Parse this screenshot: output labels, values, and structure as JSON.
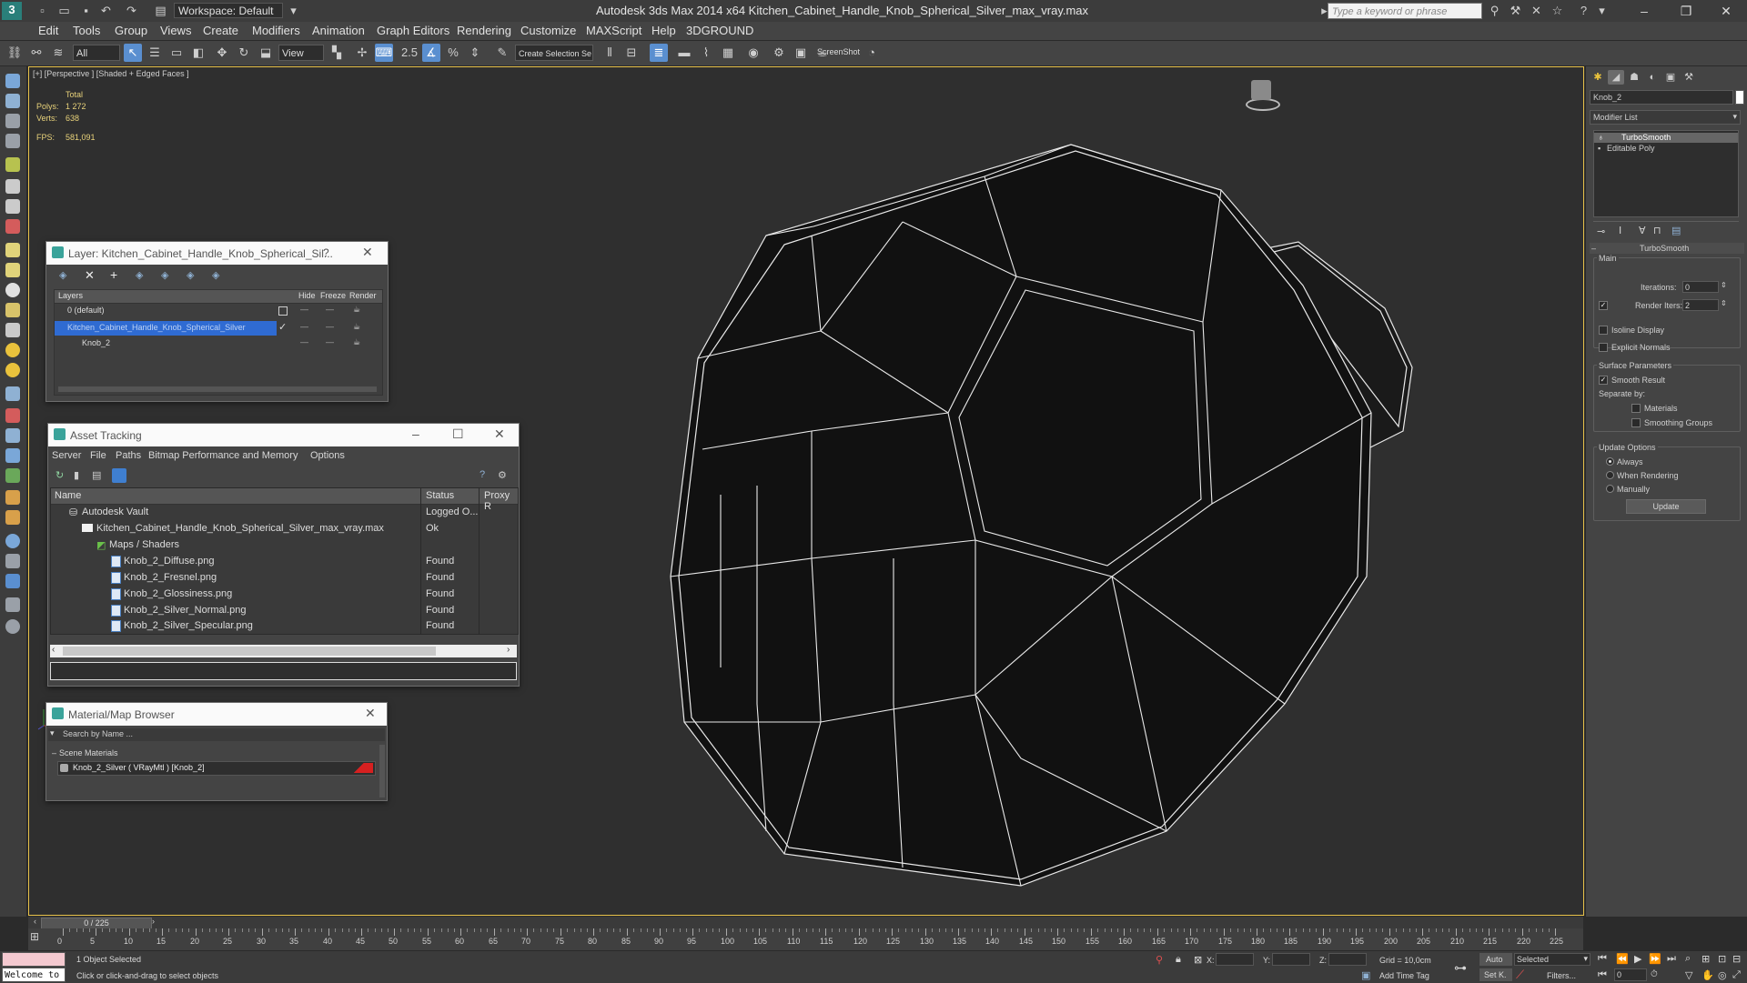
{
  "titlebar": {
    "workspace": "Workspace: Default",
    "title": "Autodesk 3ds Max  2014 x64     Kitchen_Cabinet_Handle_Knob_Spherical_Silver_max_vray.max",
    "search_placeholder": "Type a keyword or phrase"
  },
  "menu": [
    "Edit",
    "Tools",
    "Group",
    "Views",
    "Create",
    "Modifiers",
    "Animation",
    "Graph Editors",
    "Rendering",
    "Customize",
    "MAXScript",
    "Help",
    "3DGROUND"
  ],
  "toolbar": {
    "filter": "All",
    "refcoord": "View",
    "selset": "Create Selection Se",
    "screenshot": "ScreenShot"
  },
  "viewport": {
    "label": "[+] [Perspective ] [Shaded + Edged Faces ]",
    "stats_header": "Total",
    "polys_label": "Polys:",
    "polys": "1 272",
    "verts_label": "Verts:",
    "verts": "638",
    "fps_label": "FPS:",
    "fps": "581,091"
  },
  "layer_window": {
    "title": "Layer: Kitchen_Cabinet_Handle_Knob_Spherical_Sil...",
    "col_layers": "Layers",
    "col_hide": "Hide",
    "col_freeze": "Freeze",
    "col_render": "Render",
    "rows": [
      "0 (default)",
      "Kitchen_Cabinet_Handle_Knob_Spherical_Silver",
      "Knob_2"
    ]
  },
  "asset_window": {
    "title": "Asset Tracking",
    "menu": [
      "Server",
      "File",
      "Paths",
      "Bitmap Performance and Memory",
      "Options"
    ],
    "col_name": "Name",
    "col_status": "Status",
    "col_proxy": "Proxy R",
    "rows": [
      {
        "name": "Autodesk Vault",
        "status": "Logged O..."
      },
      {
        "name": "Kitchen_Cabinet_Handle_Knob_Spherical_Silver_max_vray.max",
        "status": "Ok"
      },
      {
        "name": "Maps / Shaders",
        "status": ""
      },
      {
        "name": "Knob_2_Diffuse.png",
        "status": "Found"
      },
      {
        "name": "Knob_2_Fresnel.png",
        "status": "Found"
      },
      {
        "name": "Knob_2_Glossiness.png",
        "status": "Found"
      },
      {
        "name": "Knob_2_Silver_Normal.png",
        "status": "Found"
      },
      {
        "name": "Knob_2_Silver_Specular.png",
        "status": "Found"
      }
    ]
  },
  "material_window": {
    "title": "Material/Map Browser",
    "search_placeholder": "Search by Name ...",
    "section": "Scene Materials",
    "item": "Knob_2_Silver  ( VRayMtl )  [Knob_2]"
  },
  "command_panel": {
    "object_name": "Knob_2",
    "modifier_list": "Modifier List",
    "stack": [
      "TurboSmooth",
      "Editable Poly"
    ],
    "rollout_title": "TurboSmooth",
    "main_label": "Main",
    "iterations_label": "Iterations:",
    "iterations": "0",
    "render_iters_label": "Render Iters:",
    "render_iters": "2",
    "isoline": "Isoline Display",
    "explicit_normals": "Explicit Normals",
    "surface_params": "Surface Parameters",
    "smooth_result": "Smooth Result",
    "separate_by": "Separate by:",
    "materials": "Materials",
    "smoothing_groups": "Smoothing Groups",
    "update_options": "Update Options",
    "always": "Always",
    "when_rendering": "When Rendering",
    "manually": "Manually",
    "update_button": "Update"
  },
  "timeline": {
    "frame_display": "0 / 225",
    "ticks": [
      "0",
      "5",
      "10",
      "15",
      "20",
      "25",
      "30",
      "35",
      "40",
      "45",
      "50",
      "55",
      "60",
      "65",
      "70",
      "75",
      "80",
      "85",
      "90",
      "95",
      "100",
      "105",
      "110",
      "115",
      "120",
      "125",
      "130",
      "135",
      "140",
      "145",
      "150",
      "155",
      "160",
      "165",
      "170",
      "175",
      "180",
      "185",
      "190",
      "195",
      "200",
      "205",
      "210",
      "215",
      "220",
      "225"
    ]
  },
  "status": {
    "maxscript": "Welcome to",
    "selected": "1 Object Selected",
    "prompt": "Click or click-and-drag to select objects",
    "x_label": "X:",
    "y_label": "Y:",
    "z_label": "Z:",
    "grid": "Grid = 10,0cm",
    "add_time_tag": "Add Time Tag",
    "auto": "Auto",
    "set_key": "Set K.",
    "key_mode": "Selected",
    "filters": "Filters...",
    "frame": "0"
  }
}
